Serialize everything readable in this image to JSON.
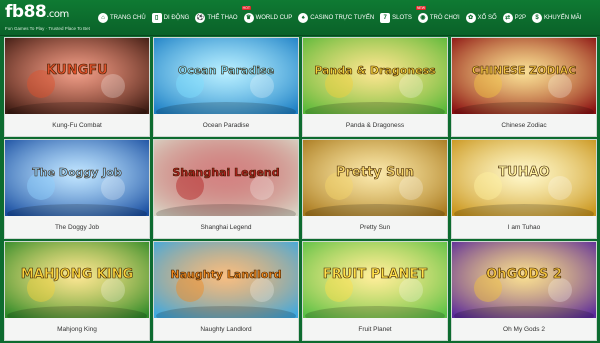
{
  "brand": {
    "logo": "fb88",
    "logo_suffix": ".com",
    "tagline": "Fun Games To Play · Trusted Place To Bet"
  },
  "nav": {
    "items": [
      {
        "label": "TRANG CHỦ",
        "icon": "home-icon",
        "glyph": "⌂"
      },
      {
        "label": "DI ĐỘNG",
        "icon": "mobile-icon",
        "glyph": "▯"
      },
      {
        "label": "THỂ THAO",
        "icon": "soccer-icon",
        "glyph": "⚽"
      },
      {
        "label": "WORLD CUP",
        "icon": "trophy-icon",
        "glyph": "♛",
        "badge": "HOT"
      },
      {
        "label": "CASINO TRỰC TUYẾN",
        "icon": "cards-icon",
        "glyph": "♠"
      },
      {
        "label": "SLOTS",
        "icon": "slot-machine-icon",
        "glyph": "7"
      },
      {
        "label": "TRÒ CHƠI",
        "icon": "gamepad-icon",
        "glyph": "◉",
        "badge": "NEW"
      },
      {
        "label": "XỔ SỐ",
        "icon": "lottery-icon",
        "glyph": "✿"
      },
      {
        "label": "P2P",
        "icon": "p2p-icon",
        "glyph": "⇄"
      },
      {
        "label": "KHUYẾN MÃI",
        "icon": "promotion-icon",
        "glyph": "$"
      }
    ]
  },
  "games": [
    {
      "name": "Kung-Fu Combat",
      "art": "KUNGFU",
      "theme": "#3b1a12",
      "accent": "#e0502a"
    },
    {
      "name": "Ocean Paradise",
      "art": "Ocean Paradise",
      "theme": "#1d7fc4",
      "accent": "#7fe0ff"
    },
    {
      "name": "Panda & Dragoness",
      "art": "Panda & Dragoness",
      "theme": "#58b83a",
      "accent": "#f5d13a"
    },
    {
      "name": "Chinese Zodiac",
      "art": "CHINESE ZODIAC",
      "theme": "#8a0f12",
      "accent": "#f4c542"
    },
    {
      "name": "The Doggy Job",
      "art": "The Doggy Job",
      "theme": "#1a4ea0",
      "accent": "#8fd0ff"
    },
    {
      "name": "Shanghai Legend",
      "art": "Shanghai Legend",
      "theme": "#d9d3c4",
      "accent": "#b21e1e"
    },
    {
      "name": "Pretty Sun",
      "art": "Pretty Sun",
      "theme": "#a8781e",
      "accent": "#f6d66a"
    },
    {
      "name": "I am Tuhao",
      "art": "TUHAO",
      "theme": "#c9941c",
      "accent": "#fff2a0"
    },
    {
      "name": "Mahjong King",
      "art": "MAHJONG KING",
      "theme": "#2f8a2a",
      "accent": "#f7d23c"
    },
    {
      "name": "Naughty Landlord",
      "art": "Naughty Landlord",
      "theme": "#3fa9e0",
      "accent": "#f28a1e"
    },
    {
      "name": "Fruit Planet",
      "art": "FRUIT PLANET",
      "theme": "#5ac046",
      "accent": "#ffe14a"
    },
    {
      "name": "Oh My Gods 2",
      "art": "OhGODS 2",
      "theme": "#5b2a9c",
      "accent": "#f3c43c"
    }
  ]
}
